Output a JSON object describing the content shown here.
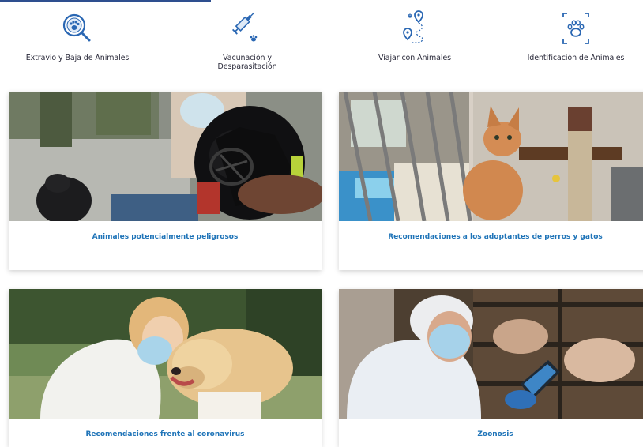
{
  "services": [
    {
      "label": "Extravío y Baja de Animales",
      "icon": "search-paw-icon"
    },
    {
      "label": "Vacunación y\nDesparasitación",
      "icon": "syringe-paw-icon"
    },
    {
      "label": "Viajar con Animales",
      "icon": "route-paw-icon"
    },
    {
      "label": "Identificación de Animales",
      "icon": "scan-paw-icon"
    }
  ],
  "cards": [
    {
      "title": "Animales potencialmente peligrosos",
      "image": "muzzled-dog-photo"
    },
    {
      "title": "Recomendaciones a los adoptantes de perros y gatos",
      "image": "cat-in-shelter-photo"
    },
    {
      "title": "Recomendaciones frente al coronavirus",
      "image": "woman-mask-dog-photo"
    },
    {
      "title": "Zoonosis",
      "image": "vet-mask-tablet-photo"
    }
  ],
  "colors": {
    "accent": "#1f74b8",
    "topbar": "#2e4f8f",
    "icon": "#2a67b3"
  }
}
